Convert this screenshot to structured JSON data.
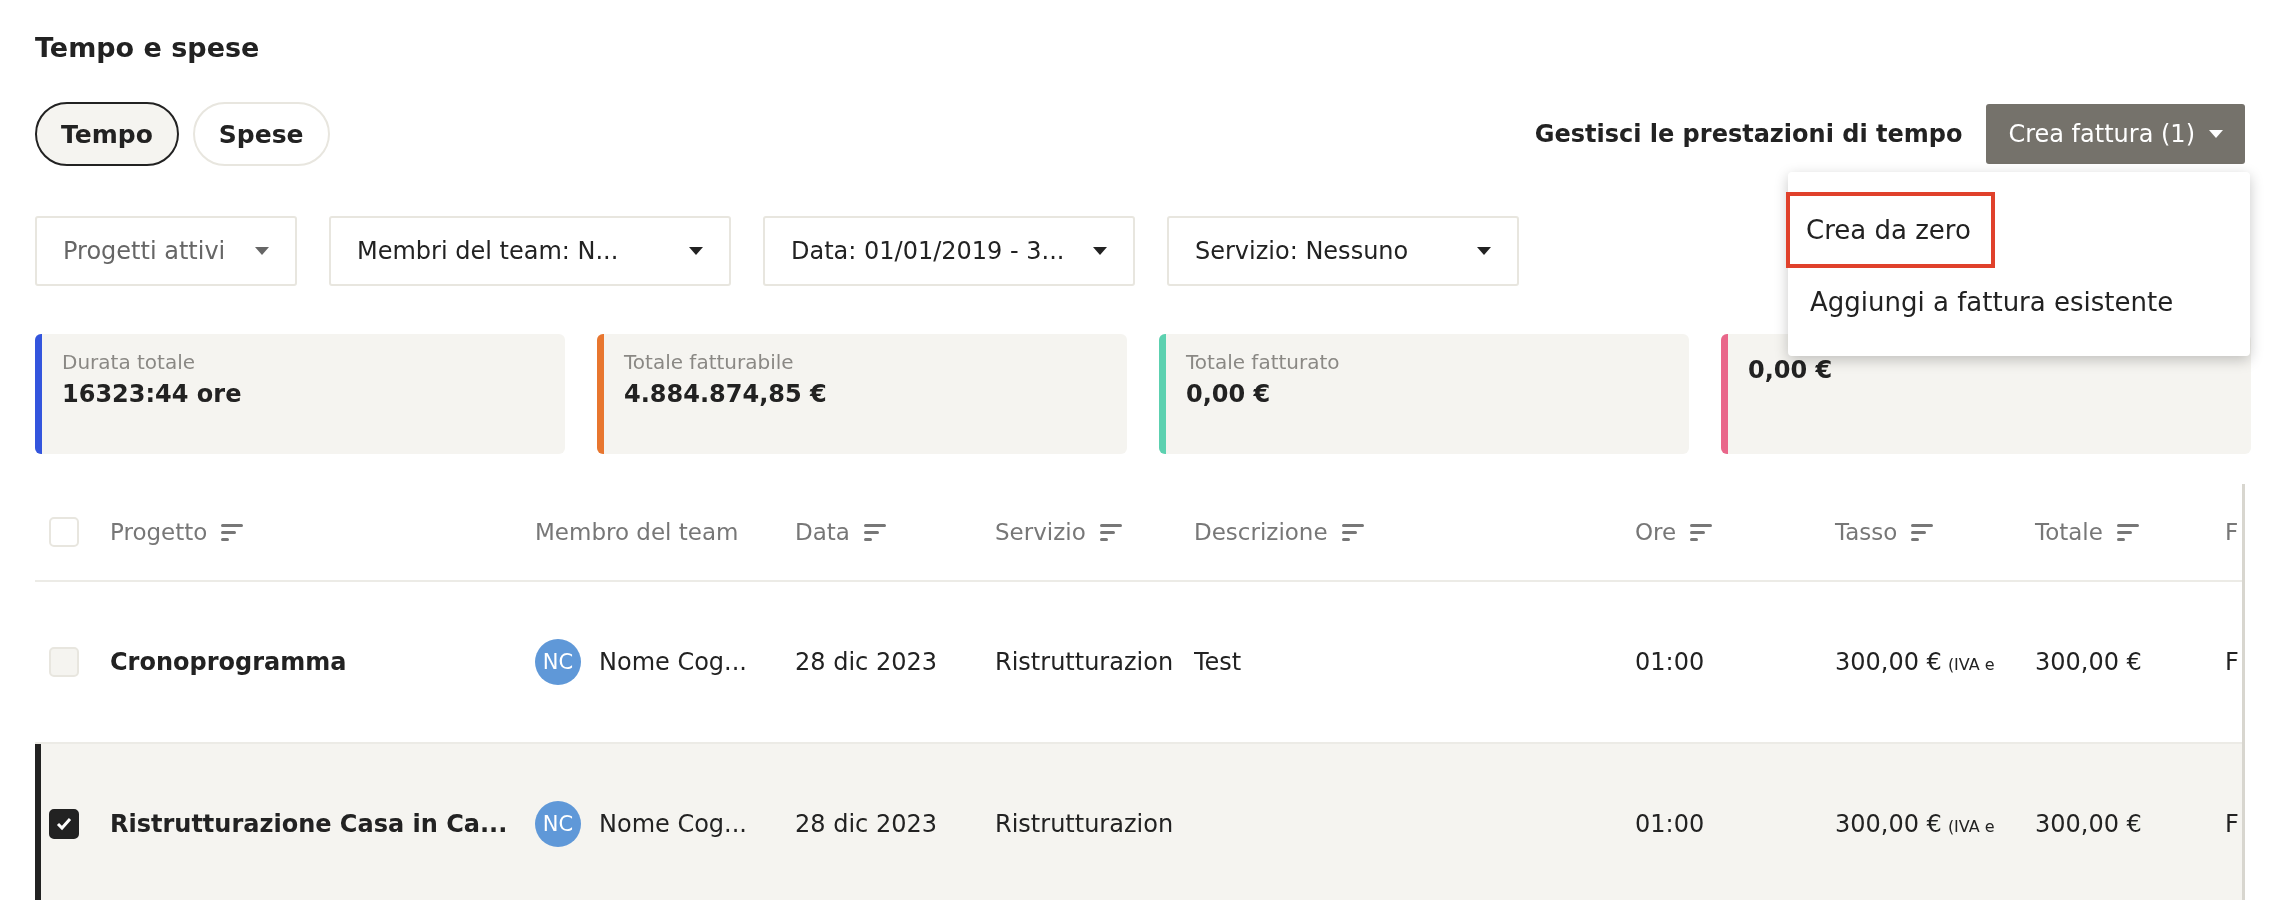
{
  "page_title": "Tempo e spese",
  "tabs": [
    {
      "label": "Tempo",
      "selected": true
    },
    {
      "label": "Spese",
      "selected": false
    }
  ],
  "manage_link": "Gestisci le prestazioni di tempo",
  "create_invoice": {
    "label": "Crea fattura (1)",
    "menu": [
      {
        "label": "Crea da zero",
        "highlighted": true
      },
      {
        "label": "Aggiungi a fattura esistente",
        "highlighted": false
      }
    ]
  },
  "filters": [
    {
      "label": "Progetti attivi",
      "placeholder": true
    },
    {
      "label": "Membri del team: N...",
      "placeholder": false
    },
    {
      "label": "Data: 01/01/2019 - 3...",
      "placeholder": false
    },
    {
      "label": "Servizio: Nessuno",
      "placeholder": false
    }
  ],
  "stats": [
    {
      "label": "Durata totale",
      "value": "16323:44 ore",
      "color": "#3355dd"
    },
    {
      "label": "Totale fatturabile",
      "value": "4.884.874,85 €",
      "color": "#e8762f"
    },
    {
      "label": "Totale fatturato",
      "value": "0,00 €",
      "color": "#5cd1b0"
    },
    {
      "value": "0,00 €",
      "color": "#e9668a"
    }
  ],
  "table": {
    "all_checked": false,
    "columns": [
      {
        "label": "Progetto",
        "sortable": true
      },
      {
        "label": "Membro del team",
        "sortable": false
      },
      {
        "label": "Data",
        "sortable": true
      },
      {
        "label": "Servizio",
        "sortable": true
      },
      {
        "label": "Descrizione",
        "sortable": true
      },
      {
        "label": "Ore",
        "sortable": true
      },
      {
        "label": "Tasso",
        "sortable": true
      },
      {
        "label": "Totale",
        "sortable": true
      },
      {
        "label": "F"
      }
    ],
    "rows": [
      {
        "selected": false,
        "project": "Cronoprogramma",
        "avatar": "NC",
        "member": "Nome Cog...",
        "date": "28 dic 2023",
        "service": "Ristrutturazion",
        "description": "Test",
        "hours": "01:00",
        "rate": "300,00 €",
        "rate_note": "(IVA e",
        "total": "300,00 €",
        "column_9": "F"
      },
      {
        "selected": true,
        "project": "Ristrutturazione Casa in Ca...",
        "avatar": "NC",
        "member": "Nome Cog...",
        "date": "28 dic 2023",
        "service": "Ristrutturazion",
        "hours": "01:00",
        "rate": "300,00 €",
        "rate_note": "(IVA e",
        "total": "300,00 €",
        "column_9": "F"
      }
    ]
  }
}
